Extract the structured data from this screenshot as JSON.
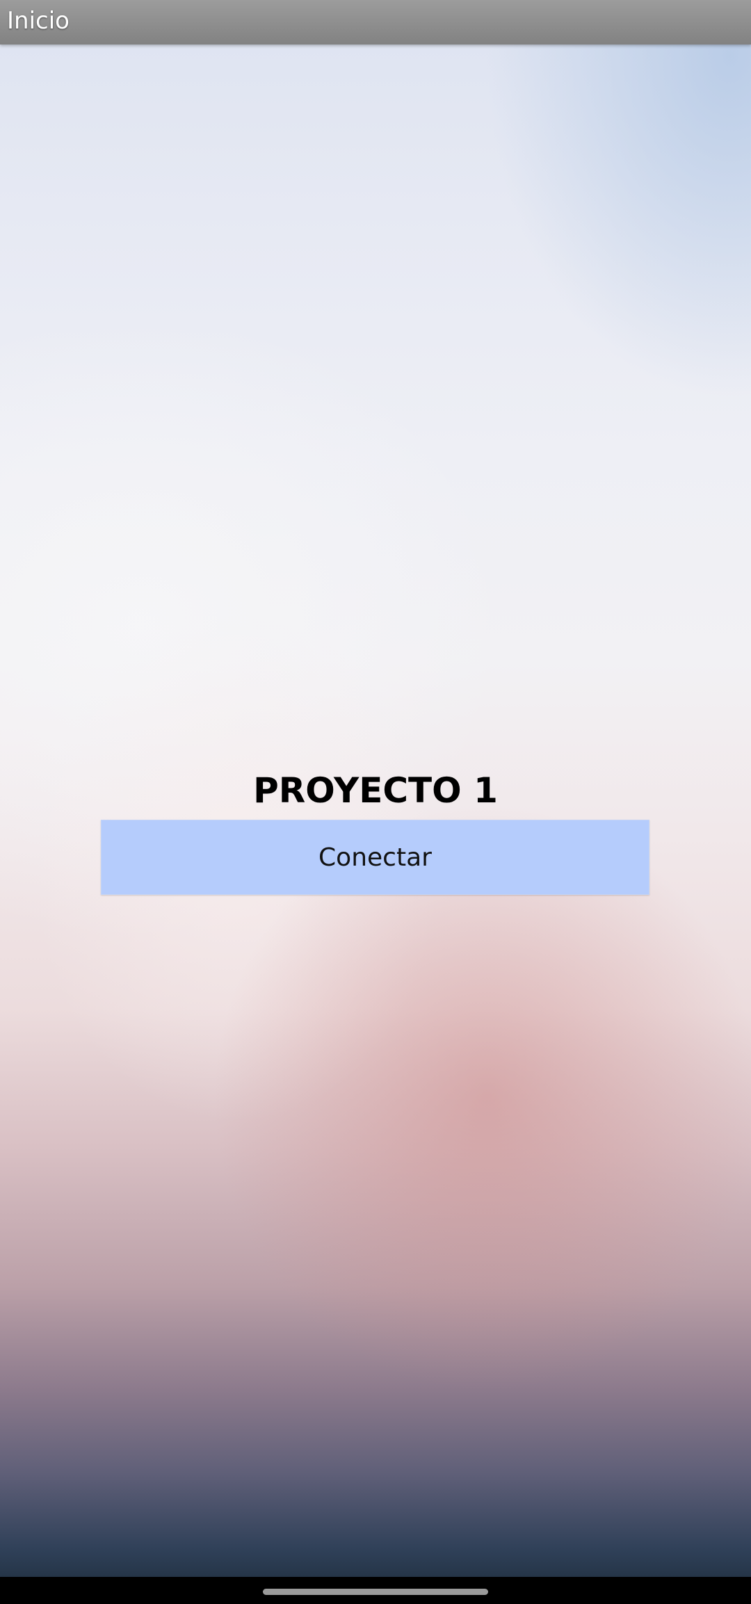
{
  "appbar": {
    "title": "Inicio"
  },
  "main": {
    "project_title": "PROYECTO 1",
    "connect_label": "Conectar"
  },
  "colors": {
    "appbar": "#8e8e8e",
    "button": "#b5ccfc",
    "title_text": "#000000"
  }
}
